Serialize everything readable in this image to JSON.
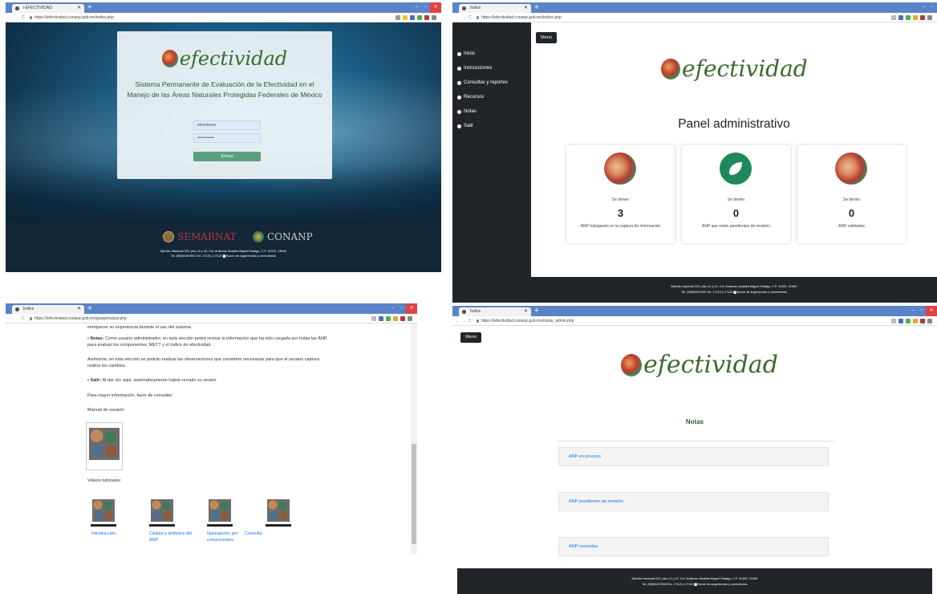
{
  "w1": {
    "tab_title": "i-EFECTIVIDAD",
    "url": "https://iefectividad.conanp.gob.mx/index.php",
    "logo": "efectividad",
    "system_title": "Sistema Permanente de Evaluación de la Efectividad en el Manejo de las Áreas Naturales Protegidas Federales de México",
    "username_value": "etsustama",
    "password_value": "••••••••••••",
    "login_button": "Entrar",
    "semarnat": "SEMARNAT",
    "conanp": "CONANP",
    "footer_line1": "Ejército Nacional 223, piso 11 y 12, Col. Anáhuac Alcaldía Miguel Hidalgo, C.P. 11320, CDMX",
    "footer_line2": "Tel. (55)54497000 Ext. 17115 y 17124 ▆ Buzón de sugerencias y comentarios"
  },
  "w2": {
    "tab_title": "Índice",
    "url": "https://iefectividad.conanp.gob.mx/indice.php",
    "menu_button": "Menú",
    "sidebar": [
      {
        "label": "Inicio",
        "icon": "home-icon"
      },
      {
        "label": "Instrucciones",
        "icon": "question-icon"
      },
      {
        "label": "Consultas y reportes",
        "icon": "user-icon"
      },
      {
        "label": "Recursos",
        "icon": "book-icon"
      },
      {
        "label": "Notas",
        "icon": "user-icon"
      },
      {
        "label": "Salir",
        "icon": "gear-icon"
      }
    ],
    "logo": "efectividad",
    "panel_title": "Panel administrativo",
    "cards": [
      {
        "pre": "Se tienen",
        "count": "3",
        "desc": "ANP trabajando en la captura de información"
      },
      {
        "pre": "Se tienen",
        "count": "0",
        "desc": "ANP que están pendientes de revisión"
      },
      {
        "pre": "Se tienen",
        "count": "0",
        "desc": "ANP validadas"
      }
    ],
    "footer_line1": "Ejército Nacional 223, piso 11 y 12, Col. Anáhuac Alcaldía Miguel Hidalgo, C.P. 11320, CDMX",
    "footer_line2": "Tel. (55)54497000 Ext. 17115 y 17124 ▆ Buzón de sugerencias y comentarios"
  },
  "w3": {
    "tab_title": "Índice",
    "url": "https://iefectividad.conanp.gob.mx/guiaprincipal.php",
    "p_top": "enriquecer su experiencia durante el uso del sistema.",
    "notas_label": "• Notas:",
    "notas_text": " Como usuario administrador, en esta sección podrá revisar la información que ha sido cargada por todas las ANP, para evaluar los componentes, METT y el índice de efectividad.",
    "p_asimismo": "Asimismo, en esta sección se podrán realizar las observaciones que considere necesarias para que el usuario captura realice los cambios.",
    "salir_label": "• Salir:",
    "salir_text": " Al dar clic aquí, automáticamente habrá cerrado su sesión.",
    "p_info": "Para mayor información, favor de consultar:",
    "p_manual": "Manual de usuario:",
    "p_videos": "Videos tutoriales:",
    "videos": [
      "Introducción",
      "Cédula y atributos del ANP",
      "Navegación por componentes",
      "Consulta"
    ]
  },
  "w4": {
    "tab_title": "Índice",
    "url": "https://iefectividad.conanp.gob.mx/notas_admin.php",
    "menu_button": "Menú",
    "logo": "efectividad",
    "notes_title": "Notas",
    "accordions": [
      "ANP en proceso",
      "ANP pendientes de revisión",
      "ANP revisadas"
    ],
    "footer_line1": "Ejército Nacional 223, piso 11 y 12, Col. Anáhuac Alcaldía Miguel Hidalgo, C.P. 11320, CDMX",
    "footer_line2": "Tel. (55)54497000 Ext. 17115 y 17124 ▆ Buzón de sugerencias y comentarios"
  }
}
